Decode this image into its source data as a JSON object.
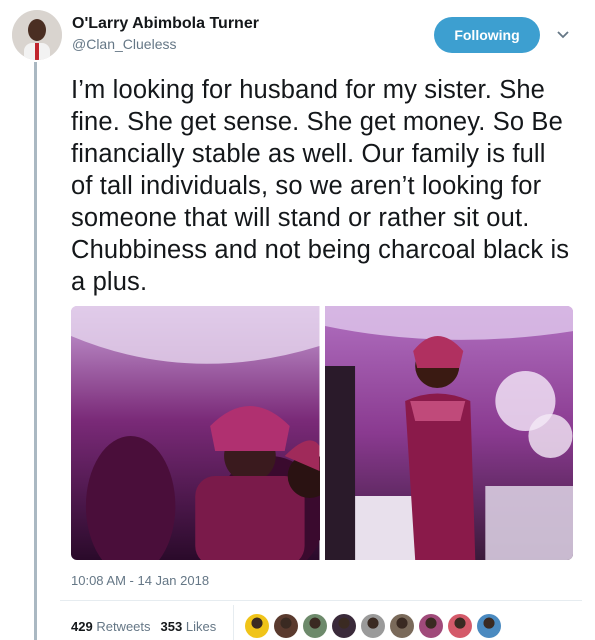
{
  "author": {
    "name": "O'Larry Abimbola Turner",
    "handle": "@Clan_Clueless"
  },
  "follow_button": {
    "label": "Following"
  },
  "tweet": {
    "text": "I’m looking for husband for my sister. She fine. She get sense. She get money. So Be financially stable as well. Our family is full of tall individuals, so we aren’t looking for someone that will stand or rather sit out. Chubbiness and not being charcoal black is a plus."
  },
  "timestamp": "10:08 AM - 14 Jan 2018",
  "stats": {
    "retweets_count": "429",
    "retweets_label": "Retweets",
    "likes_count": "353",
    "likes_label": "Likes"
  },
  "liker_colors": [
    "#f0c419",
    "#5a3a2e",
    "#6d8a6b",
    "#3a2a3a",
    "#9a9a9a",
    "#7a6a5a",
    "#a04a7a",
    "#d45a6a",
    "#4a8ac0"
  ],
  "colors": {
    "accent": "#3d9fd0",
    "photo_tint": "#8a2a8a"
  }
}
